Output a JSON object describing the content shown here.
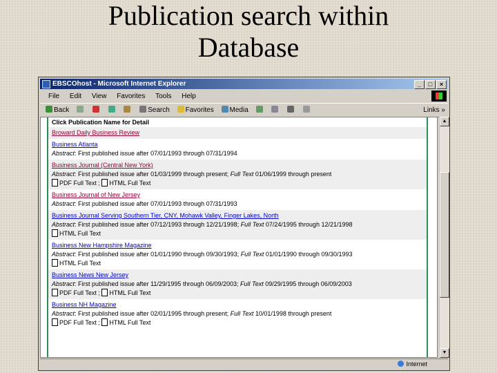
{
  "slide": {
    "title_line1": "Publication search within",
    "title_line2": "Database"
  },
  "window": {
    "title": "EBSCOhost - Microsoft Internet Explorer",
    "minimize": "_",
    "maximize": "□",
    "close": "×"
  },
  "menu": {
    "file": "File",
    "edit": "Edit",
    "view": "View",
    "favorites": "Favorites",
    "tools": "Tools",
    "help": "Help"
  },
  "toolbar": {
    "back": "Back",
    "search": "Search",
    "favorites": "Favorites",
    "media": "Media",
    "links": "Links"
  },
  "list": {
    "header": "Click Publication Name for Detail",
    "abstract_label": "Abstract",
    "fulltext_label": "Full Text",
    "pdf_label": "PDF Full Text",
    "html_label": "HTML Full Text",
    "entries": [
      {
        "name": "Broward Daily Business Review"
      },
      {
        "name": "Business Atlanta",
        "abstract": ": First published issue after 07/01/1993 through 07/31/1994"
      },
      {
        "name": "Business Journal (Central New York)",
        "abstract": ": First published issue after 01/03/1999 through present; ",
        "fulltext": " 01/06/1999 through present"
      },
      {
        "name": "Business Journal of New Jersey",
        "abstract": ": First published issue after 07/01/1993 through 07/31/1993"
      },
      {
        "name": "Business Journal Serving Southern Tier, CNY, Mohawk Valley, Finger Lakes, North",
        "abstract": ": First published issue after 07/12/1993 through 12/21/1998; ",
        "fulltext": " 07/24/1995 through 12/21/1998"
      },
      {
        "name": "Business New Hampshire Magazine",
        "abstract": ": First published issue after 01/01/1990 through 09/30/1993; ",
        "fulltext": " 01/01/1990 through 09/30/1993"
      },
      {
        "name": "Business News New Jersey",
        "abstract": ": First published issue after 11/29/1995 through 06/09/2003; ",
        "fulltext": " 09/29/1995 through 06/09/2003"
      },
      {
        "name": "Business NH Magazine",
        "abstract": ": First published issue after 02/01/1995 through present; ",
        "fulltext": " 10/01/1998 through present"
      }
    ]
  },
  "status": {
    "zone": "Internet"
  }
}
